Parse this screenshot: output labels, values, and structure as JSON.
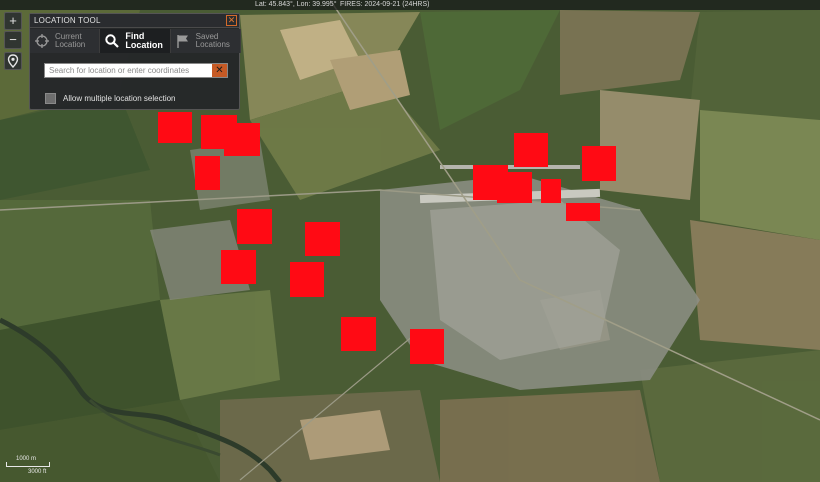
{
  "status_bar": {
    "coords": "Lat: 45.843°, Lon: 39.995°",
    "fires": "FIRES: 2024-09-21 (24HRS)"
  },
  "map_controls": {
    "zoom_in": "+",
    "zoom_out": "−",
    "locate_icon": "map-pin-icon"
  },
  "location_tool": {
    "title": "LOCATION TOOL",
    "close": "✕",
    "tabs": [
      {
        "label": "Current\nLocation",
        "icon": "crosshair-icon",
        "active": false
      },
      {
        "label": "Find\nLocation",
        "icon": "search-icon",
        "active": true
      },
      {
        "label": "Saved\nLocations",
        "icon": "flag-icon",
        "active": false
      }
    ],
    "search": {
      "placeholder": "Search for location or enter coordinates",
      "value": "",
      "clear": "✕"
    },
    "multi_select_label": "Allow multiple location selection",
    "multi_select_checked": false
  },
  "scale": {
    "metric": "1000 m",
    "imperial": "3000 ft"
  },
  "fire_detections_count": 19,
  "colors": {
    "fire_marker": "#ff0a14",
    "panel_bg": "#242629",
    "accent": "#c65a25"
  }
}
